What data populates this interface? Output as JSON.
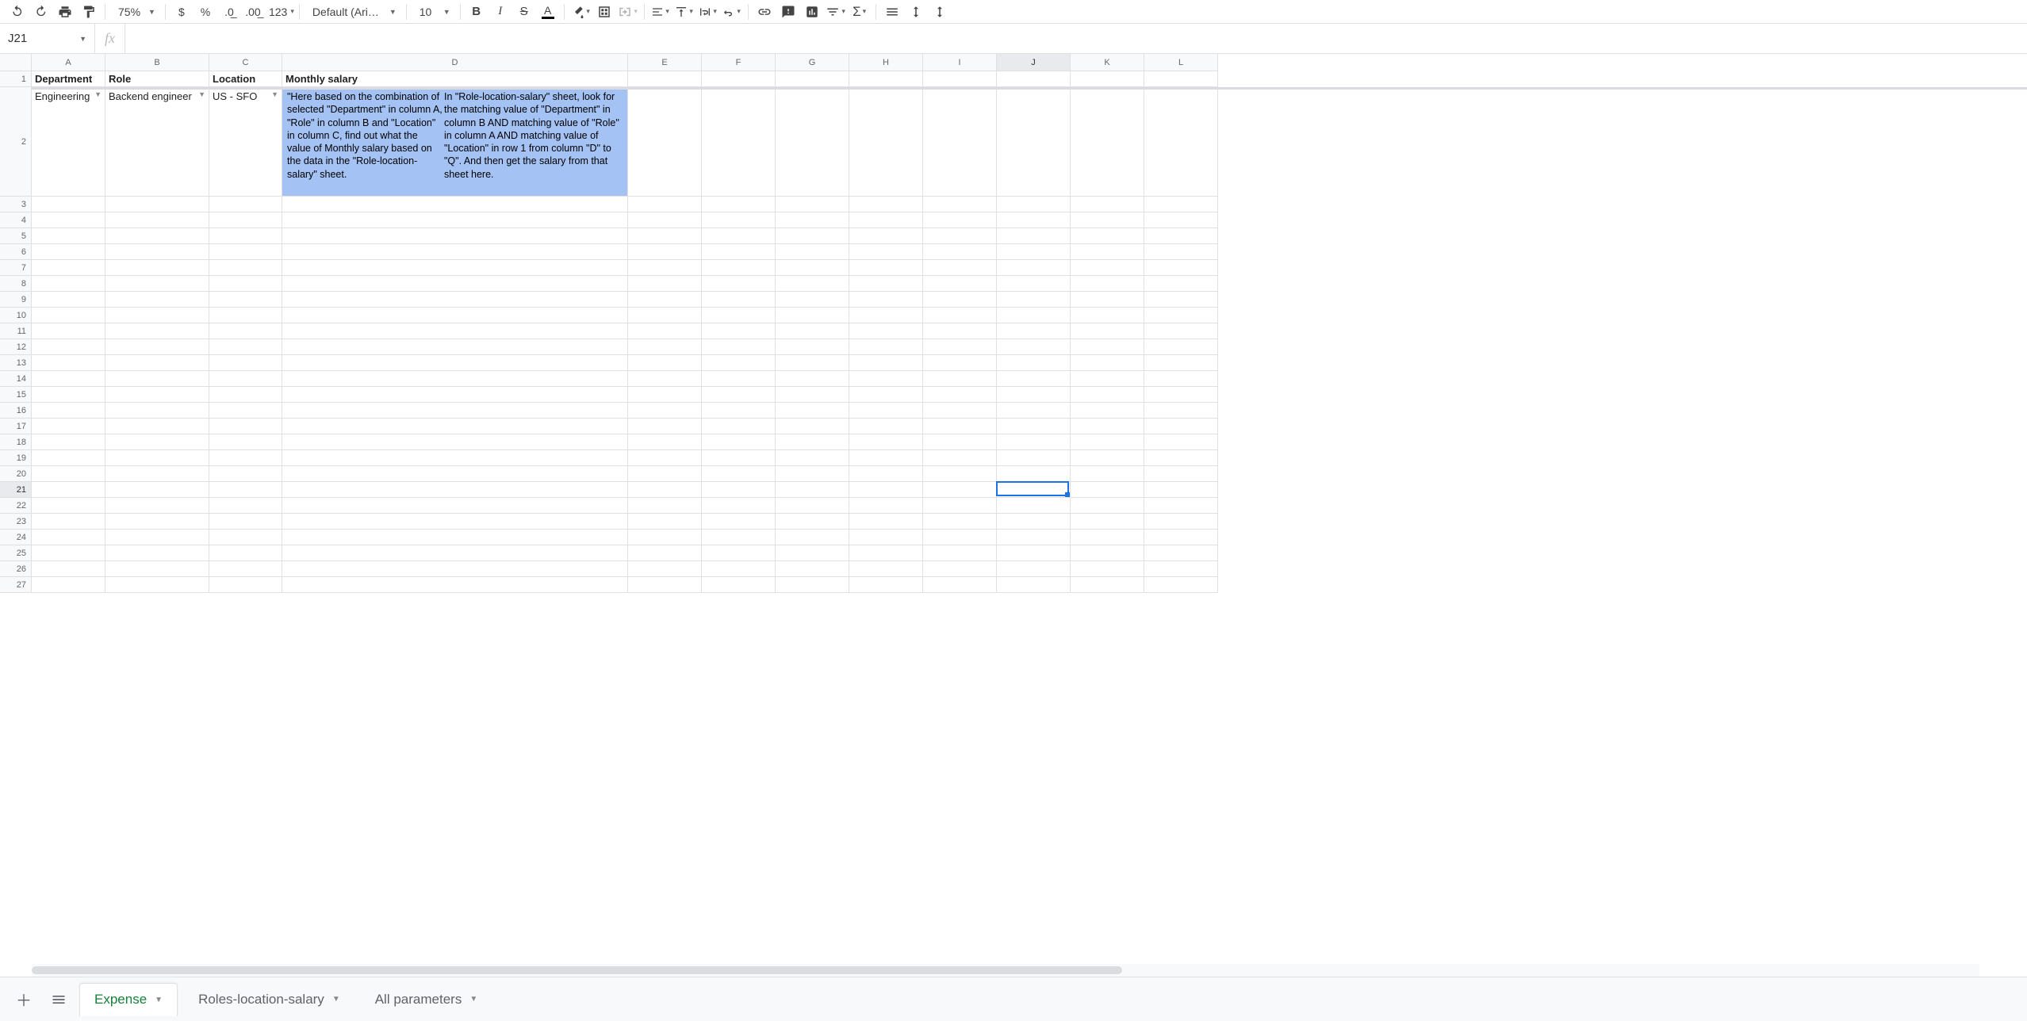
{
  "toolbar": {
    "zoom": "75%",
    "font": "Default (Ari…",
    "fontsize": "10",
    "number_format": "123"
  },
  "namebox": {
    "value": "J21"
  },
  "formula": {
    "value": ""
  },
  "columns": [
    "A",
    "B",
    "C",
    "D",
    "E",
    "F",
    "G",
    "H",
    "I",
    "J",
    "K",
    "L"
  ],
  "rows": [
    "1",
    "2",
    "3",
    "4",
    "5",
    "6",
    "7",
    "8",
    "9",
    "10",
    "11",
    "12",
    "13",
    "14",
    "15",
    "16",
    "17",
    "18",
    "19",
    "20",
    "21",
    "22",
    "23",
    "24",
    "25",
    "26",
    "27"
  ],
  "headers_row": {
    "A": "Department",
    "B": "Role",
    "C": "Location",
    "D": "Monthly salary"
  },
  "data_row": {
    "A": "Engineering",
    "B": "Backend engineer",
    "C": "US - SFO",
    "D_para1": "\"Here based on the combination of selected \"Department\" in column A, \"Role\" in column B and \"Location\" in column C, find out what the value of Monthly salary based on the data in the \"Role-location-salary\" sheet.",
    "D_para2": "In \"Role-location-salary\" sheet, look for the matching value of \"Department\" in column B AND matching value of \"Role\" in column A AND matching value of \"Location\" in row 1 from column \"D\" to \"Q\". And then get the salary from that sheet here."
  },
  "selected": {
    "column": "J",
    "row": "21"
  },
  "sheets": {
    "active": "Expense",
    "tabs": [
      "Expense",
      "Roles-location-salary",
      "All parameters"
    ]
  }
}
